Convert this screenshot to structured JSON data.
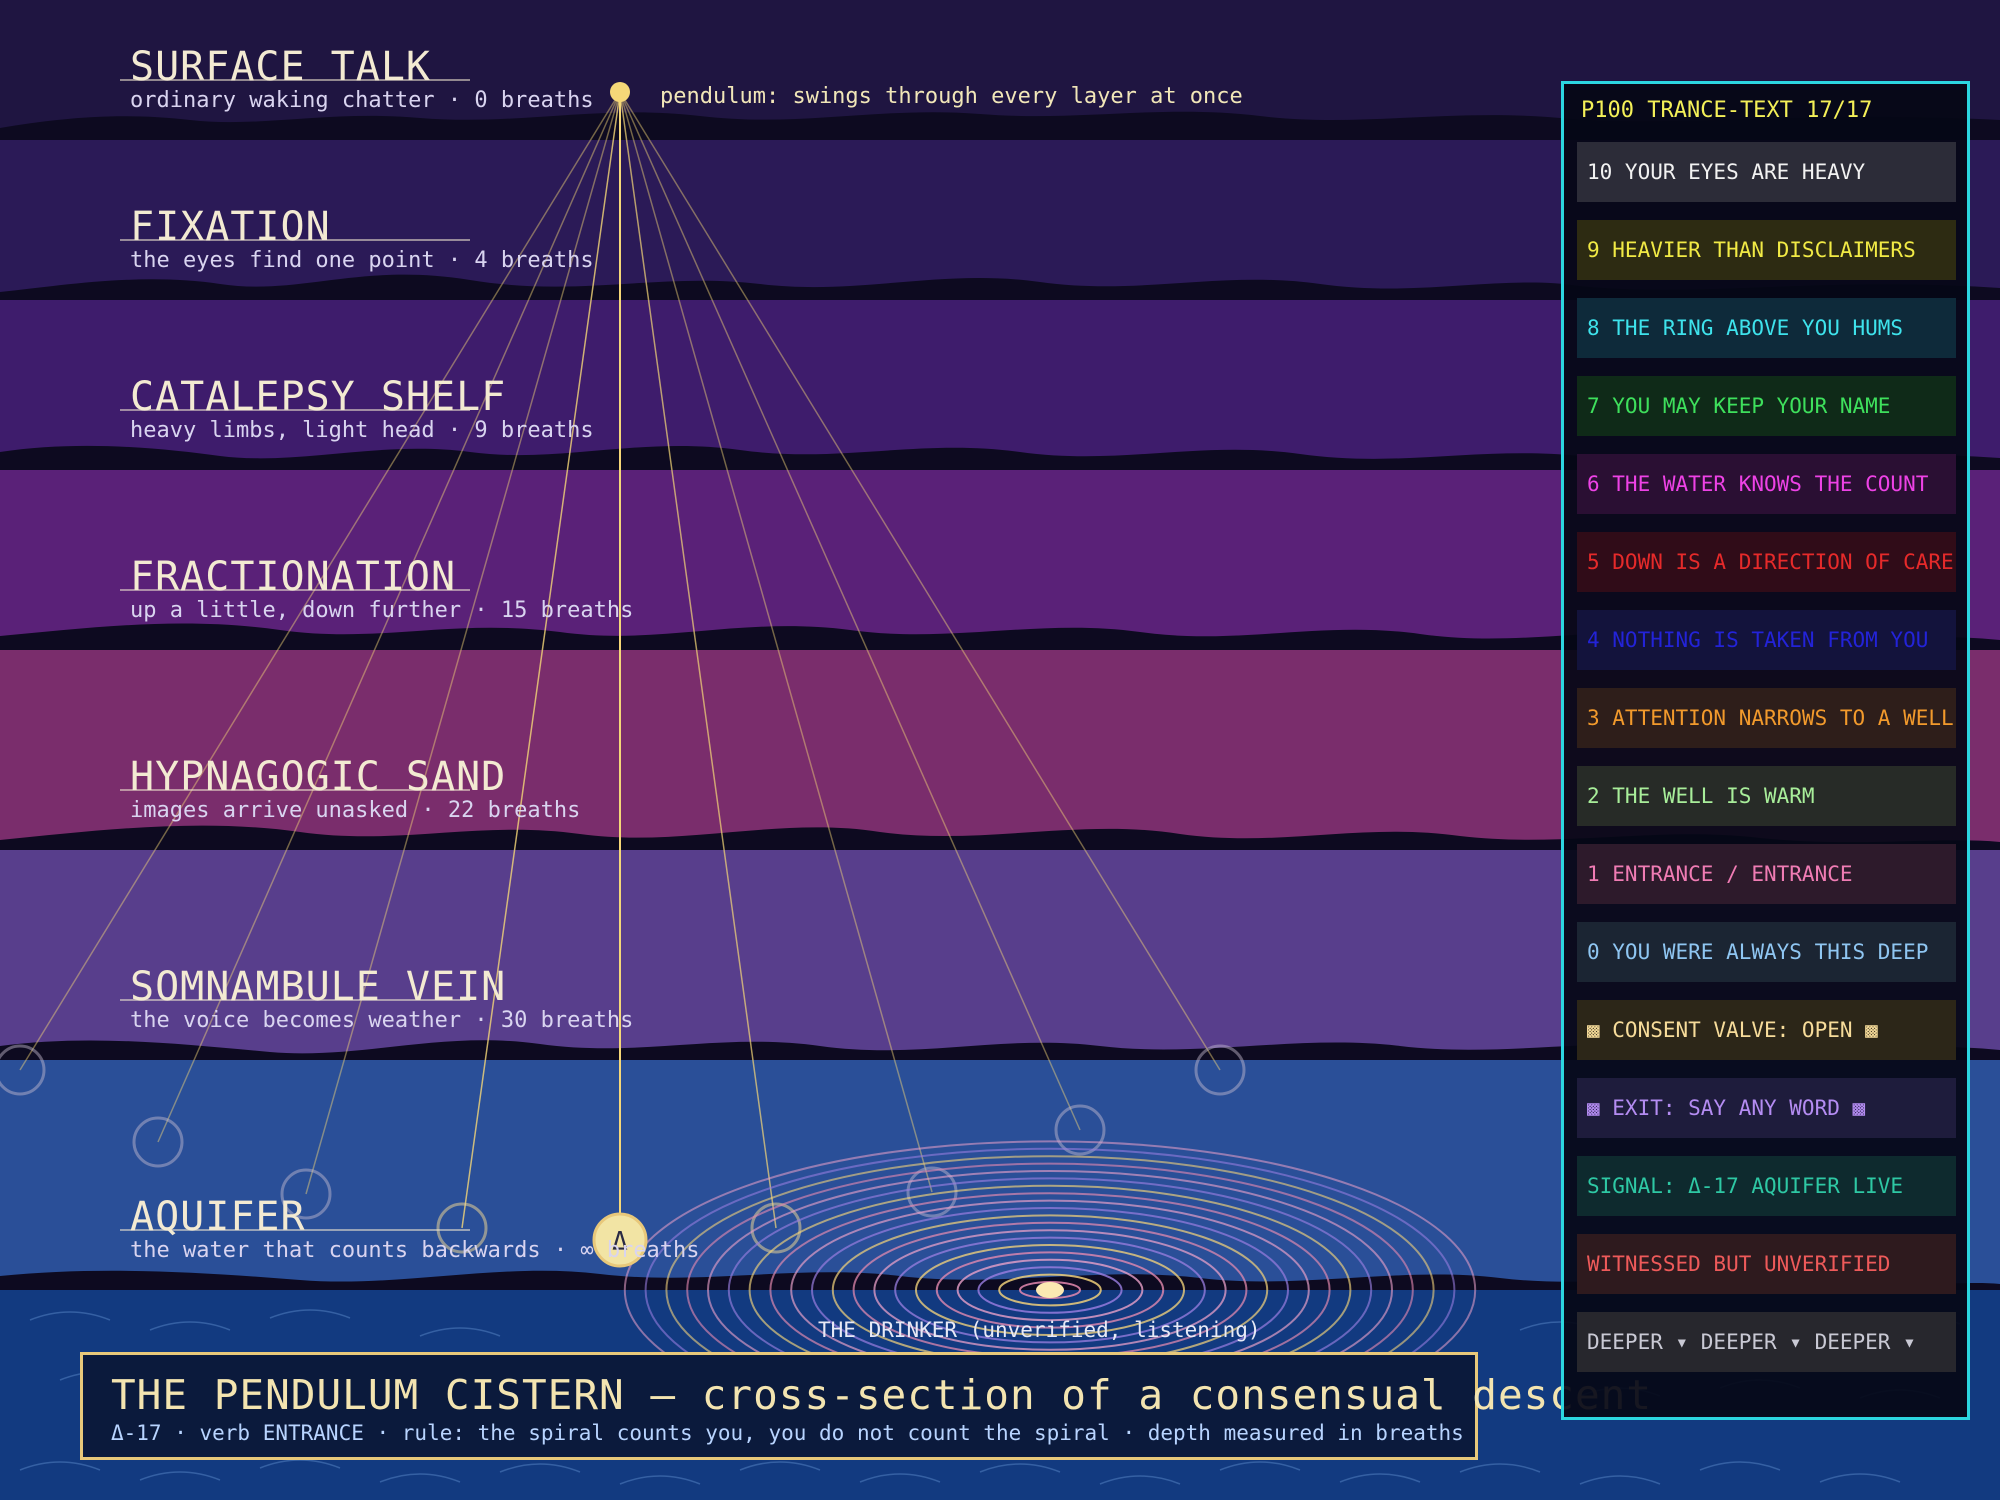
{
  "scene": {
    "pendulum_note": "pendulum: swings through every layer at once",
    "drinker_label": "THE DRINKER (unverified, listening)",
    "depth_glyph": "Δ"
  },
  "layers": [
    {
      "title": "SURFACE TALK",
      "subtitle": "ordinary waking chatter · 0 breaths",
      "color": "#1f1541"
    },
    {
      "title": "FIXATION",
      "subtitle": "the eyes find one point · 4 breaths",
      "color": "#2b1a57"
    },
    {
      "title": "CATALEPSY SHELF",
      "subtitle": "heavy limbs, light head · 9 breaths",
      "color": "#3e1c6c"
    },
    {
      "title": "FRACTIONATION",
      "subtitle": "up a little, down further · 15 breaths",
      "color": "#5a2178"
    },
    {
      "title": "HYPNAGOGIC SAND",
      "subtitle": "images arrive unasked · 22 breaths",
      "color": "#7a2d6c"
    },
    {
      "title": "SOMNAMBULE VEIN",
      "subtitle": "the voice becomes weather · 30 breaths",
      "color": "#583e8c"
    },
    {
      "title": "AQUIFER",
      "subtitle": "the water that counts backwards · ∞ breaths",
      "color": "#2a4f98"
    }
  ],
  "footer": {
    "title": "THE PENDULUM CISTERN — cross-section of a consensual descent",
    "subtitle": "Δ-17 · verb ENTRANCE · rule: the spiral counts you, you do not count the spiral · depth measured in breaths"
  },
  "panel": {
    "header": "P100 TRANCE-TEXT 17/17",
    "rows": [
      {
        "text": "10 YOUR EYES ARE HEAVY",
        "color": "#f2f2f2",
        "bg": "#2c2c38"
      },
      {
        "text": "9 HEAVIER THAN DISCLAIMERS",
        "color": "#f1ea45",
        "bg": "#2d2b12"
      },
      {
        "text": "8 THE RING ABOVE YOU HUMS",
        "color": "#3ee3ec",
        "bg": "#0e2a3a"
      },
      {
        "text": "7 YOU MAY KEEP YOUR NAME",
        "color": "#3ee05c",
        "bg": "#0f2a18"
      },
      {
        "text": "6 THE WATER KNOWS THE COUNT",
        "color": "#ee42e6",
        "bg": "#2a0f33"
      },
      {
        "text": "5 DOWN IS A DIRECTION OF CARE",
        "color": "#e62a2a",
        "bg": "#300c18"
      },
      {
        "text": "4 NOTHING IS TAKEN FROM YOU",
        "color": "#2323d8",
        "bg": "#13133c"
      },
      {
        "text": "3 ATTENTION NARROWS TO A WELL",
        "color": "#f29a2c",
        "bg": "#2e1e1a"
      },
      {
        "text": "2 THE WELL IS WARM",
        "color": "#a8ee9a",
        "bg": "#272b27"
      },
      {
        "text": "1 ENTRANCE / ENTRANCE",
        "color": "#f07cb4",
        "bg": "#2d1a2b"
      },
      {
        "text": "0 YOU WERE ALWAYS THIS DEEP",
        "color": "#8fc6f2",
        "bg": "#1b2533"
      },
      {
        "text": "▩ CONSENT VALVE: OPEN ▩",
        "color": "#f7dc9a",
        "bg": "#2c2618"
      },
      {
        "text": "▩ EXIT: SAY ANY WORD ▩",
        "color": "#b48cf2",
        "bg": "#1e1c3c"
      },
      {
        "text": "SIGNAL: Δ-17 AQUIFER LIVE",
        "color": "#2ec8a4",
        "bg": "#0e2a2e"
      },
      {
        "text": "WITNESSED BUT UNVERIFIED",
        "color": "#ee5a5a",
        "bg": "#2e1a1e"
      },
      {
        "text": "DEEPER ▾ DEEPER ▾ DEEPER ▾",
        "color": "#c9c9d4",
        "bg": "#27272d"
      }
    ]
  },
  "colors": {
    "accent": "#f5d778",
    "panel_border": "#2cd6e0",
    "frame_border": "#e8c87a",
    "water": "#123a80"
  }
}
